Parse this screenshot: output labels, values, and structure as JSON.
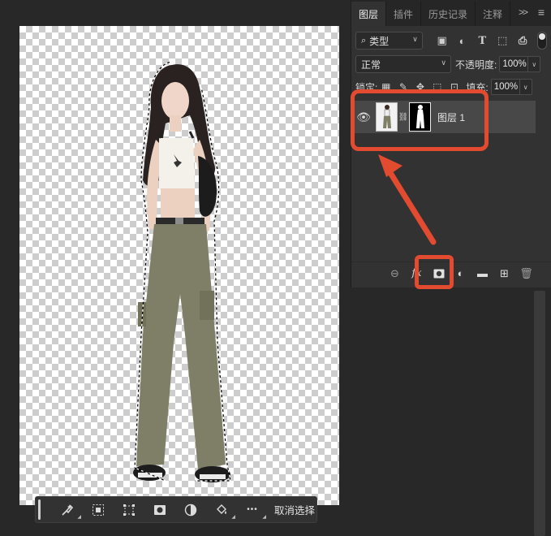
{
  "panel": {
    "tabs": [
      {
        "label": "图层",
        "active": true
      },
      {
        "label": "插件",
        "active": false
      },
      {
        "label": "历史记录",
        "active": false
      },
      {
        "label": "注释",
        "active": false
      }
    ],
    "more_icon": "double-chevron-right-icon",
    "menu_icon": "hamburger-menu-icon",
    "filter": {
      "icon": "search-icon",
      "value": "类型"
    },
    "filter_icons": [
      "image-filter-icon",
      "adjustment-filter-icon",
      "type-filter-icon",
      "shape-filter-icon",
      "smart-object-filter-icon"
    ],
    "blend_mode": "正常",
    "opacity": {
      "label": "不透明度:",
      "value": "100%"
    },
    "lock": {
      "label": "锁定:",
      "icons": [
        "lock-transparent-icon",
        "lock-paint-icon",
        "lock-position-icon",
        "lock-artboard-icon",
        "lock-all-icon"
      ]
    },
    "fill": {
      "label": "填充:",
      "value": "100%"
    },
    "layer": {
      "name": "图层 1",
      "visible": true
    },
    "bottom_icons": [
      "link-layers-icon",
      "fx-icon",
      "add-mask-icon",
      "adjustment-layer-icon",
      "new-group-icon",
      "new-layer-icon",
      "delete-layer-icon"
    ],
    "fx_text": "fx"
  },
  "taskbar": {
    "icons": [
      "select-subject-brush-icon",
      "select-subject-icon",
      "transform-selection-icon",
      "mask-icon",
      "invert-icon",
      "fill-icon",
      "more-icon"
    ],
    "more_text": "•••",
    "deselect_label": "取消选择"
  },
  "annotation": {
    "color": "#e24b2f"
  }
}
